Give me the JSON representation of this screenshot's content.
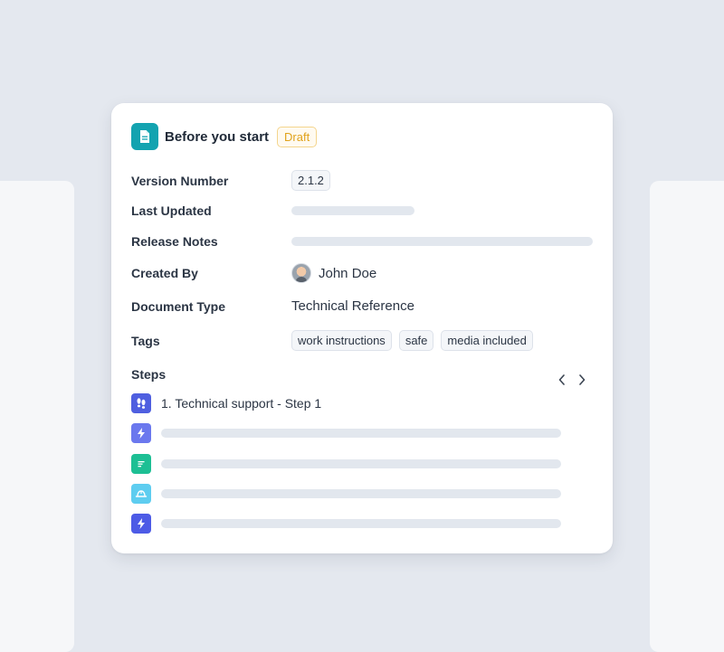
{
  "card": {
    "title": "Before you start",
    "status_badge": "Draft",
    "doc_icon": "document-icon"
  },
  "fields": {
    "version_label": "Version Number",
    "version_value": "2.1.2",
    "last_updated_label": "Last Updated",
    "release_notes_label": "Release Notes",
    "created_by_label": "Created By",
    "created_by_value": "John Doe",
    "document_type_label": "Document Type",
    "document_type_value": "Technical Reference",
    "tags_label": "Tags",
    "tags": [
      "work instructions",
      "safe",
      "media included"
    ]
  },
  "steps": {
    "title": "Steps",
    "items": [
      {
        "icon": "footprints-icon",
        "color": "#4f5fe0",
        "label": "1. Technical support - Step 1"
      },
      {
        "icon": "lightning-icon",
        "color": "#6b78ee",
        "label": ""
      },
      {
        "icon": "text-lines-icon",
        "color": "#1dbf94",
        "label": ""
      },
      {
        "icon": "hard-hat-icon",
        "color": "#5ecdf0",
        "label": ""
      },
      {
        "icon": "lightning-icon",
        "color": "#4d5be6",
        "label": ""
      }
    ]
  },
  "colors": {
    "background": "#e4e8ef",
    "accent_teal": "#13a3b0",
    "draft_text": "#e0a21b",
    "skeleton": "#e2e7ee"
  }
}
